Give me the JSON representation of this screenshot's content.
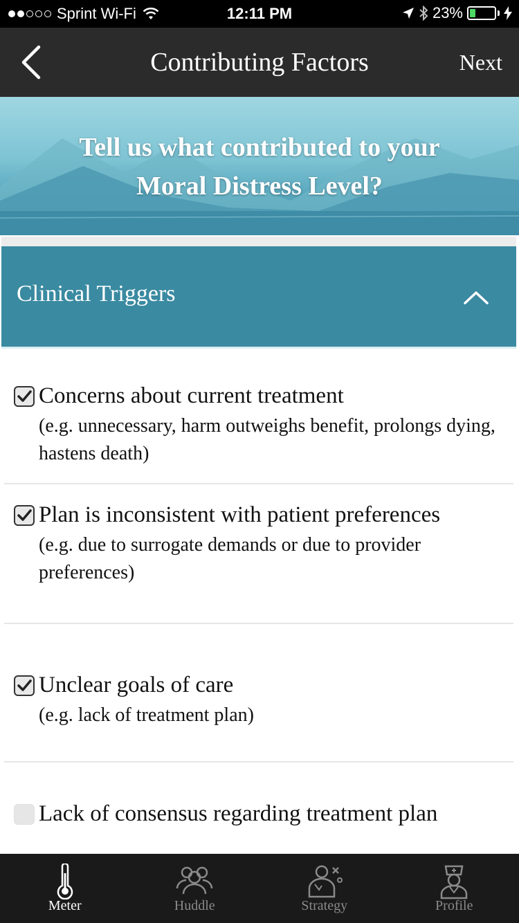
{
  "status_bar": {
    "carrier": "Sprint Wi-Fi",
    "time": "12:11 PM",
    "battery": "23%",
    "battery_level": 0.23,
    "signal_dots_filled": 2,
    "signal_dots_total": 5
  },
  "nav": {
    "title": "Contributing Factors",
    "next_label": "Next"
  },
  "hero": {
    "line1": "Tell us what contributed to your",
    "line2": "Moral Distress Level?"
  },
  "section": {
    "title": "Clinical Triggers",
    "expanded": true,
    "items": [
      {
        "title": "Concerns about current treatment",
        "description": "(e.g. unnecessary, harm outweighs benefit, prolongs dying, hastens death)",
        "checked": true
      },
      {
        "title": "Plan is inconsistent with patient preferences",
        "description": "(e.g. due to surrogate demands or due to provider preferences)",
        "checked": true
      },
      {
        "title": "Unclear goals of care",
        "description": "(e.g. lack of treatment plan)",
        "checked": true
      },
      {
        "title": "Lack of consensus regarding treatment plan",
        "description": "",
        "checked": false
      }
    ]
  },
  "tabs": [
    {
      "label": "Meter",
      "icon": "thermometer-icon",
      "active": true
    },
    {
      "label": "Huddle",
      "icon": "group-icon",
      "active": false
    },
    {
      "label": "Strategy",
      "icon": "strategy-icon",
      "active": false
    },
    {
      "label": "Profile",
      "icon": "nurse-icon",
      "active": false
    }
  ],
  "colors": {
    "section_header": "#3a8aa1",
    "nav_bar": "#2b2b2b",
    "tab_bar": "#1a1a1a",
    "battery_fill": "#4cd964"
  }
}
